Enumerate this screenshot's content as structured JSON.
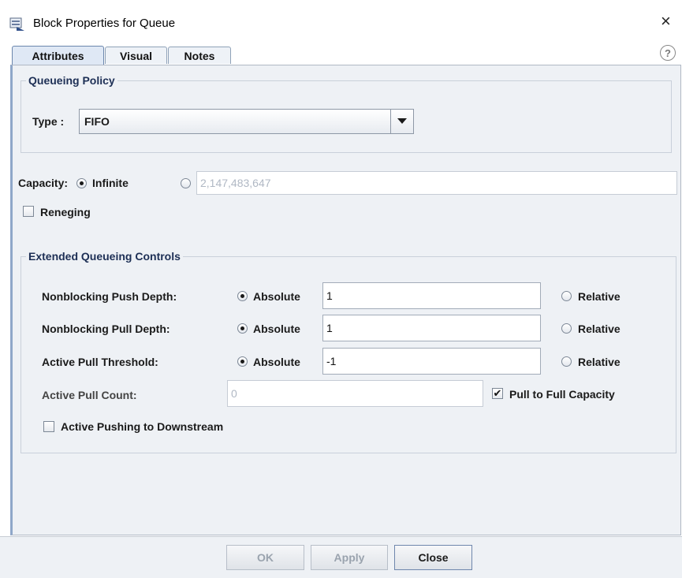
{
  "window": {
    "title": "Block Properties for Queue",
    "close_glyph": "×",
    "icon": "queue-block-icon"
  },
  "tabs": [
    {
      "label": "Attributes",
      "active": true
    },
    {
      "label": "Visual",
      "active": false
    },
    {
      "label": "Notes",
      "active": false
    }
  ],
  "help_glyph": "?",
  "queueing_policy": {
    "legend": "Queueing Policy",
    "type_label": "Type :",
    "type_value": "FIFO"
  },
  "capacity": {
    "label": "Capacity:",
    "infinite_label": "Infinite",
    "infinite_selected": true,
    "finite_value": "2,147,483,647"
  },
  "reneging": {
    "label": "Reneging",
    "checked": false
  },
  "extended": {
    "legend": "Extended Queueing Controls",
    "rows": [
      {
        "label": "Nonblocking Push Depth:",
        "absolute_label": "Absolute",
        "value": "1",
        "relative_label": "Relative"
      },
      {
        "label": "Nonblocking Pull Depth:",
        "absolute_label": "Absolute",
        "value": "1",
        "relative_label": "Relative"
      },
      {
        "label": "Active Pull Threshold:",
        "absolute_label": "Absolute",
        "value": "-1",
        "relative_label": "Relative"
      }
    ],
    "active_pull_count_label": "Active Pull Count:",
    "active_pull_count_value": "0",
    "pull_to_full_label": "Pull to Full Capacity",
    "pull_to_full_checked": true,
    "active_pushing_label": "Active Pushing to Downstream",
    "active_pushing_checked": false
  },
  "buttons": {
    "ok": "OK",
    "apply": "Apply",
    "close": "Close"
  },
  "colors": {
    "panel_bg": "#eef1f5",
    "group_title": "#1d2f55",
    "disabled_text": "#b0b8c4"
  }
}
